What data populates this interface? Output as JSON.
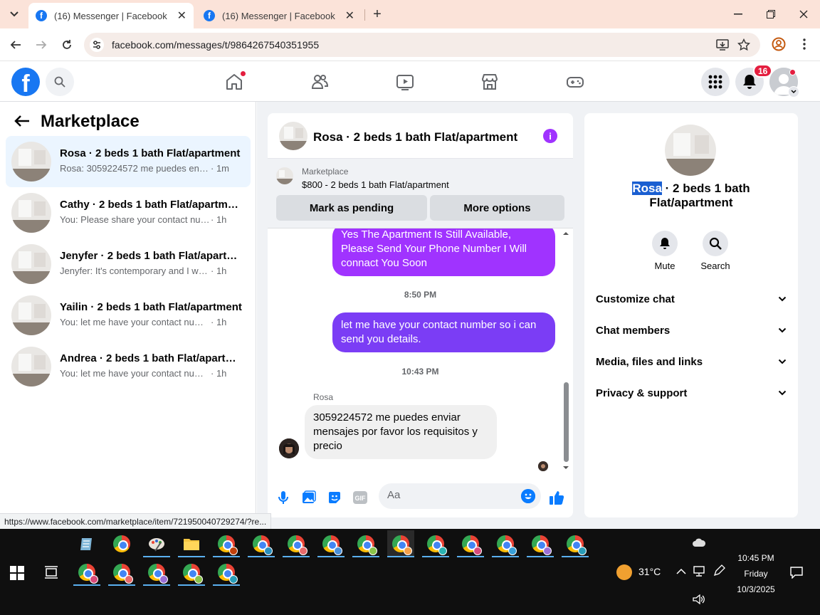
{
  "browser": {
    "tabs": [
      {
        "title": "(16) Messenger | Facebook",
        "active": true
      },
      {
        "title": "(16) Messenger | Facebook",
        "active": false
      }
    ],
    "url": "facebook.com/messages/t/9864267540351955",
    "status_url": "https://www.facebook.com/marketplace/item/721950040729274/?re..."
  },
  "fb": {
    "logo": "f",
    "notifications_count": "16",
    "brand_color": "#1877f2"
  },
  "sidebar": {
    "title": "Marketplace",
    "conversations": [
      {
        "name": "Rosa · 2 beds 1 bath Flat/apartment",
        "preview": "Rosa: 3059224572 me puedes enviar ...",
        "time": "· 1m",
        "active": true
      },
      {
        "name": "Cathy · 2 beds 1 bath Flat/apartment",
        "preview": "You: Please share your contact numbe...",
        "time": "· 1h",
        "active": false
      },
      {
        "name": "Jenyfer · 2 beds 1 bath Flat/apartm...",
        "preview": "Jenyfer: It's contemporary and I wasn'...",
        "time": "· 1h",
        "active": false
      },
      {
        "name": "Yailin · 2 beds 1 bath Flat/apartment",
        "preview": "You: let me have your contact number...",
        "time": "· 1h",
        "active": false
      },
      {
        "name": "Andrea · 2 beds 1 bath Flat/apartm...",
        "preview": "You: let me have your contact number...",
        "time": "· 1h",
        "active": false
      }
    ]
  },
  "chat": {
    "title": "Rosa · 2 beds 1 bath Flat/apartment",
    "marketplace_label": "Marketplace",
    "listing": "$800 - 2 beds 1 bath Flat/apartment",
    "mark_pending": "Mark as pending",
    "more_options": "More options",
    "messages": {
      "m1": "Yes The Apartment Is Still Available, Please Send Your Phone Number I Will connact You Soon",
      "ts1": "8:50 PM",
      "m2": "let me have your contact number so i can send you details.",
      "ts2": "10:43 PM",
      "sender": "Rosa",
      "m3": "3059224572 me puedes enviar mensajes por favor los requisitos y precio"
    },
    "composer_placeholder": "Aa",
    "accent_color": "#a033ff"
  },
  "details": {
    "name_highlight": "Rosa",
    "name_rest": " · 2 beds 1 bath Flat/apartment",
    "actions": [
      {
        "label": "Mute",
        "icon": "bell-icon"
      },
      {
        "label": "Search",
        "icon": "search-icon"
      }
    ],
    "sections": [
      "Customize chat",
      "Chat members",
      "Media, files and links",
      "Privacy & support"
    ]
  },
  "taskbar": {
    "temperature": "31°C",
    "time": "10:45 PM",
    "day": "Friday",
    "date": "10/3/2025"
  }
}
